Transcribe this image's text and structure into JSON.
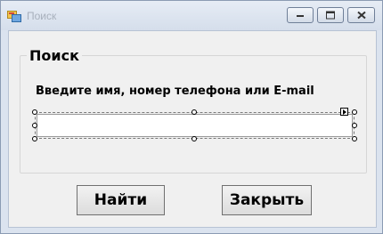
{
  "window": {
    "title": "Поиск",
    "icon": "window-app-icon"
  },
  "caption_buttons": {
    "minimize_icon": "minimize-icon",
    "maximize_icon": "maximize-icon",
    "close_icon": "close-icon"
  },
  "group": {
    "title": "Поиск"
  },
  "search": {
    "prompt": "Введите имя, номер телефона или E-mail",
    "value": ""
  },
  "buttons": {
    "find": "Найти",
    "close": "Закрыть"
  }
}
